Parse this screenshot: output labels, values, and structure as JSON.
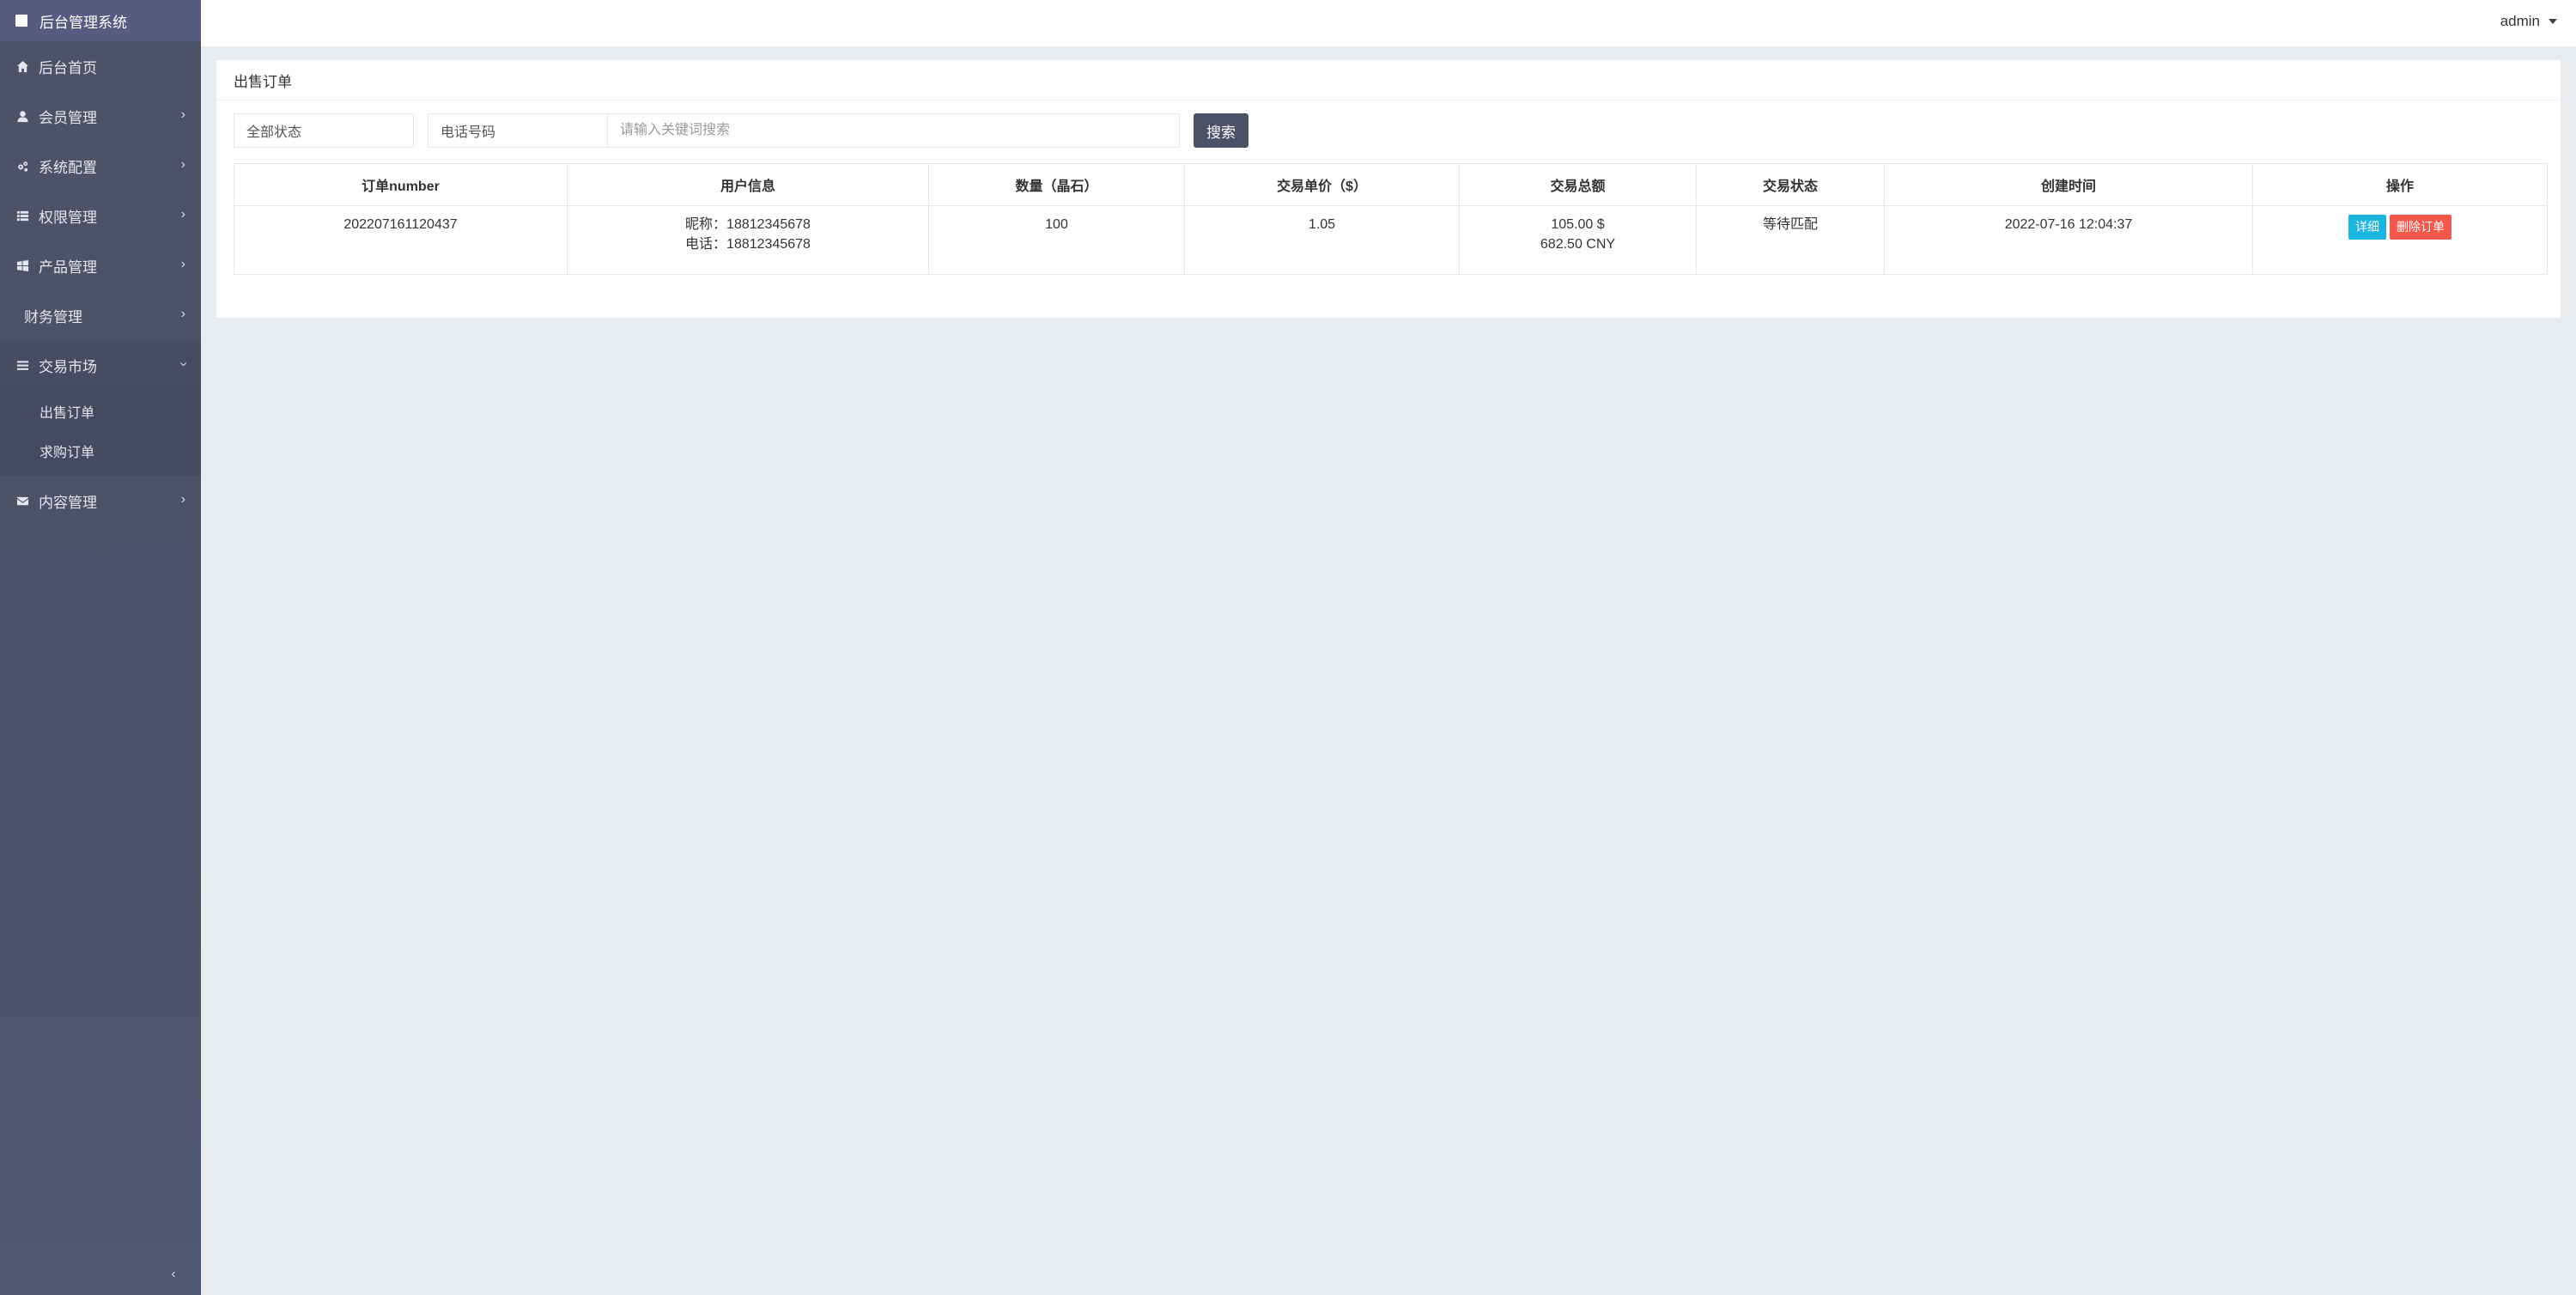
{
  "brand": {
    "title": "后台管理系统"
  },
  "sidebar": {
    "items": [
      {
        "label": "后台首页",
        "icon": "home-icon"
      },
      {
        "label": "会员管理",
        "icon": "user-icon"
      },
      {
        "label": "系统配置",
        "icon": "gears-icon"
      },
      {
        "label": "权限管理",
        "icon": "list-icon"
      },
      {
        "label": "产品管理",
        "icon": "windows-icon"
      },
      {
        "label": "财务管理",
        "icon": ""
      },
      {
        "label": "交易市场",
        "icon": "bars-icon",
        "sub": [
          "出售订单",
          "求购订单"
        ]
      },
      {
        "label": "内容管理",
        "icon": "envelope-icon"
      }
    ]
  },
  "topbar": {
    "user": "admin"
  },
  "card": {
    "title": "出售订单",
    "filters": {
      "status": "全部状态",
      "field": "电话号码",
      "keyword_placeholder": "请输入关键词搜索",
      "search_label": "搜索"
    },
    "table": {
      "headers": [
        "订单number",
        "用户信息",
        "数量（晶石）",
        "交易单价（$）",
        "交易总额",
        "交易状态",
        "创建时间",
        "操作"
      ],
      "rows": [
        {
          "order_no": "202207161120437",
          "nickname": "昵称：18812345678",
          "phone": "电话：18812345678",
          "quantity": "100",
          "unit_price": "1.05",
          "total_usd": "105.00 $",
          "total_cny": "682.50 CNY",
          "status": "等待匹配",
          "created": "2022-07-16 12:04:37",
          "detail_label": "详细",
          "delete_label": "删除订单"
        }
      ]
    }
  },
  "colors": {
    "sidebar_bg": "#4c5167",
    "brand_bg": "#565b80",
    "search_btn": "#4b5266",
    "detail_btn": "#1cb5e0",
    "delete_btn": "#f2584c"
  }
}
